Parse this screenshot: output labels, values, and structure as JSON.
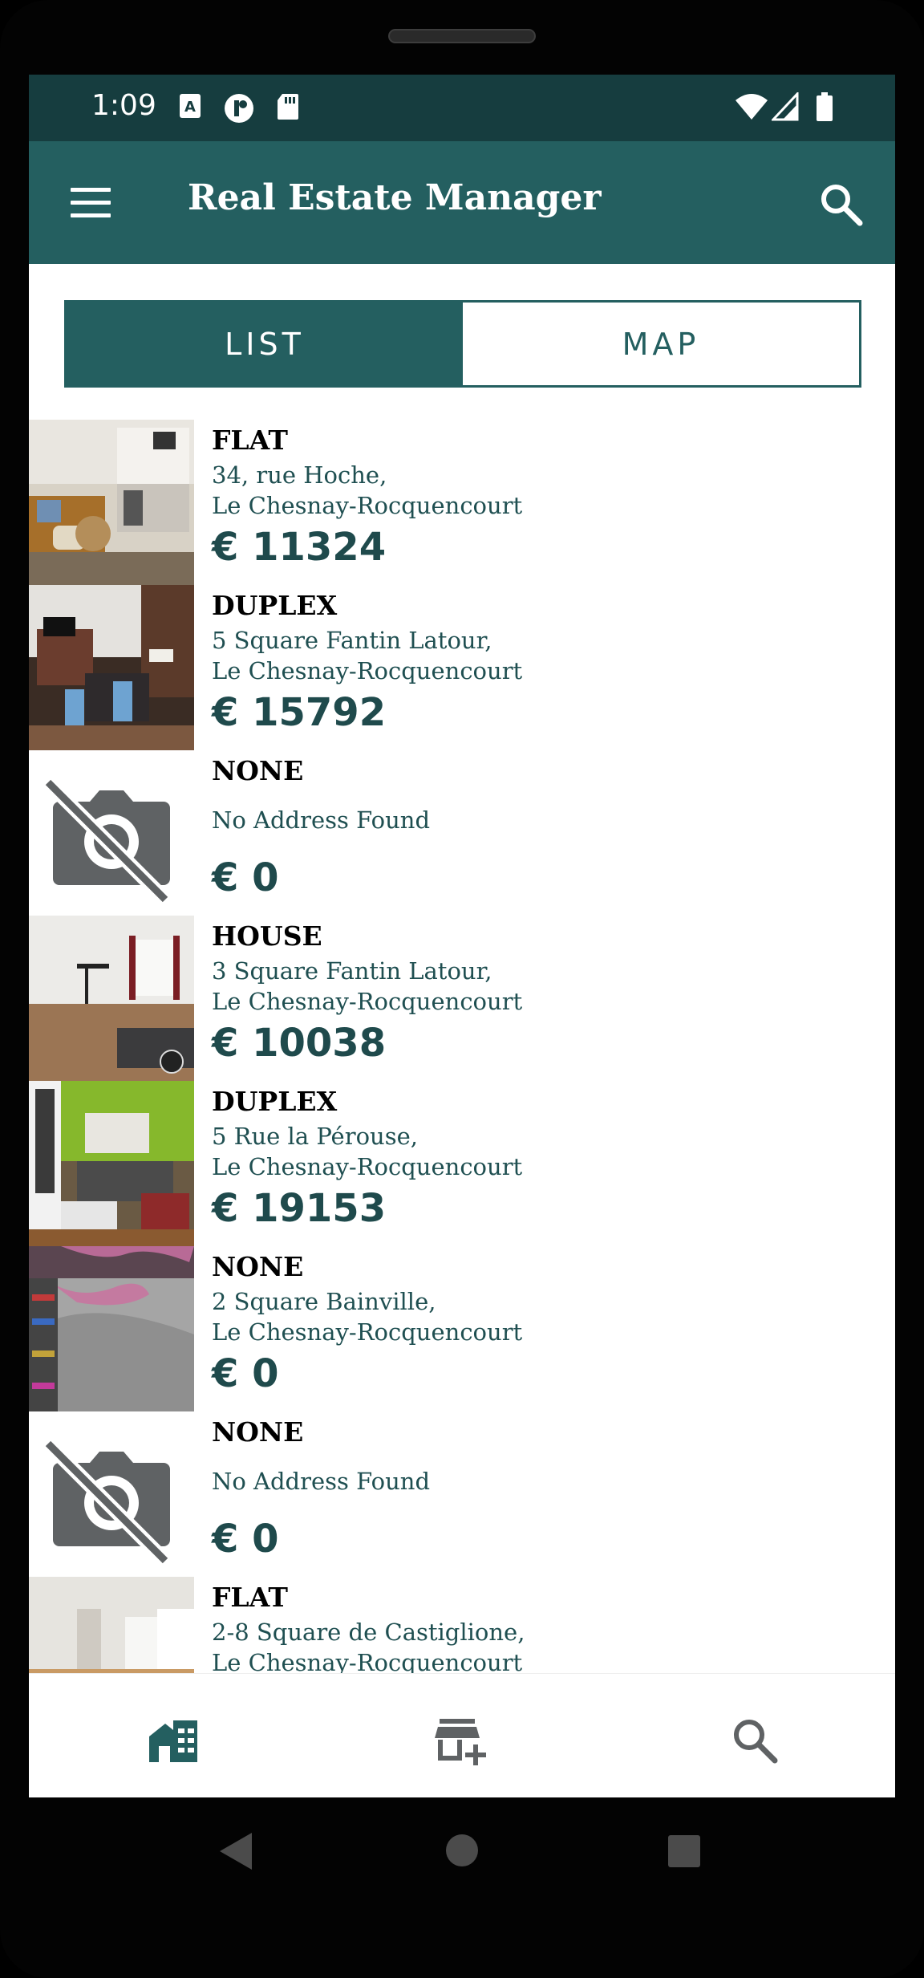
{
  "status_bar": {
    "time": "1:09"
  },
  "app_bar": {
    "title": "Real Estate Manager"
  },
  "tabs": [
    {
      "label": "LIST",
      "active": true
    },
    {
      "label": "MAP",
      "active": false
    }
  ],
  "listings": [
    {
      "type": "FLAT",
      "address_line1": "34, rue Hoche,",
      "address_line2": "Le Chesnay-Rocquencourt",
      "price": "€ 11324",
      "photo": "living-room-photo"
    },
    {
      "type": "DUPLEX",
      "address_line1": "5 Square Fantin Latour,",
      "address_line2": "Le Chesnay-Rocquencourt",
      "price": "€ 15792",
      "photo": "kitchen-photo"
    },
    {
      "type": "NONE",
      "address_line1": "No Address Found",
      "address_line2": "",
      "price": "€ 0",
      "photo": "no-photo-icon"
    },
    {
      "type": "HOUSE",
      "address_line1": "3 Square Fantin Latour,",
      "address_line2": "Le Chesnay-Rocquencourt",
      "price": "€ 10038",
      "photo": "living-room-photo"
    },
    {
      "type": "DUPLEX",
      "address_line1": "5 Rue la Pérouse,",
      "address_line2": "Le Chesnay-Rocquencourt",
      "price": "€ 19153",
      "photo": "green-kitchen-photo"
    },
    {
      "type": "NONE",
      "address_line1": "2 Square Bainville,",
      "address_line2": "Le Chesnay-Rocquencourt",
      "price": "€ 0",
      "photo": "map-photo"
    },
    {
      "type": "NONE",
      "address_line1": "No Address Found",
      "address_line2": "",
      "price": "€ 0",
      "photo": "no-photo-icon"
    },
    {
      "type": "FLAT",
      "address_line1": "2-8 Square de Castiglione,",
      "address_line2": "Le Chesnay-Rocquencourt",
      "price": "",
      "photo": "empty-room-photo"
    }
  ],
  "bottom_nav": [
    {
      "icon": "home-list-icon",
      "active": true
    },
    {
      "icon": "add-property-icon",
      "active": false
    },
    {
      "icon": "search-icon",
      "active": false
    }
  ],
  "colors": {
    "primary": "#245f60",
    "status_bar": "#163d3f",
    "price": "#1f4a4c",
    "address": "#1f4f51"
  }
}
